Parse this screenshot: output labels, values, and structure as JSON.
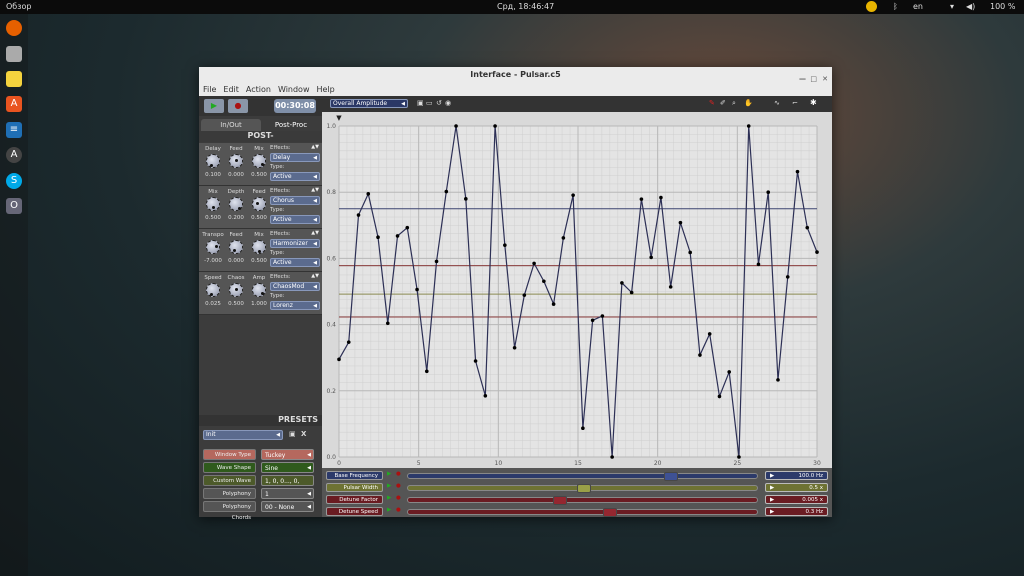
{
  "desktop": {
    "activities": "Обзор",
    "clock": "Срд, 18:46:47",
    "lang": "en",
    "battery": "100 %",
    "dock": [
      "firefox-icon",
      "files-icon",
      "notes-icon",
      "software-icon",
      "writer-icon",
      "updater-icon",
      "skype-icon",
      "app-icon"
    ]
  },
  "window": {
    "title": "Interface - Pulsar.c5",
    "menu": [
      "File",
      "Edit",
      "Action",
      "Window",
      "Help"
    ]
  },
  "transport": {
    "timer": "00:30:08"
  },
  "tabs": [
    "In/Out",
    "Post-Proc"
  ],
  "post_header": "POST-",
  "effects": [
    {
      "knobs": [
        {
          "label": "Delay",
          "value": "0.100"
        },
        {
          "label": "Feed",
          "value": "0.000"
        },
        {
          "label": "Mix",
          "value": "0.500"
        }
      ],
      "effect": "Delay",
      "type": "Active"
    },
    {
      "knobs": [
        {
          "label": "Mix",
          "value": "0.500"
        },
        {
          "label": "Depth",
          "value": "0.200"
        },
        {
          "label": "Feed",
          "value": "0.500"
        }
      ],
      "effect": "Chorus",
      "type": "Active"
    },
    {
      "knobs": [
        {
          "label": "Transpo",
          "value": "-7.000"
        },
        {
          "label": "Feed",
          "value": "0.000"
        },
        {
          "label": "Mix",
          "value": "0.500"
        }
      ],
      "effect": "Harmonizer",
      "type": "Active"
    },
    {
      "knobs": [
        {
          "label": "Speed",
          "value": "0.025"
        },
        {
          "label": "Chaos",
          "value": "0.500"
        },
        {
          "label": "Amp",
          "value": "1.000"
        }
      ],
      "effect": "ChaosMod",
      "type": "Lorenz"
    }
  ],
  "effects_label": "Effects:",
  "type_label": "Type:",
  "presets": {
    "header": "PRESETS",
    "current": "Init",
    "delete": "X",
    "rows": [
      {
        "label": "Window Type",
        "value": "Tuckey",
        "color": "#b5685e"
      },
      {
        "label": "Wave Shape",
        "value": "Sine",
        "color": "#2f5a1c"
      },
      {
        "label": "Custom Wave",
        "value": "1, 0, 0..., 0, 0.05",
        "color": "#4d5a2a"
      },
      {
        "label": "Polyphony Voices",
        "value": "1",
        "color": "#555555"
      },
      {
        "label": "Polyphony Chords",
        "value": "00 - None",
        "color": "#555555"
      }
    ]
  },
  "graph_select": "Overall Amplitude",
  "sliders": [
    {
      "label": "Base Frequency",
      "value": "100.0 Hz",
      "color": "#2c3a6a",
      "pos": 0.76
    },
    {
      "label": "Pulsar Width",
      "value": "0.5 x",
      "color": "#6e7233",
      "pos": 0.5
    },
    {
      "label": "Detune Factor",
      "value": "0.005 x",
      "color": "#6a1c22",
      "pos": 0.43
    },
    {
      "label": "Detune Speed",
      "value": "0.3 Hz",
      "color": "#6a1c22",
      "pos": 0.58
    }
  ],
  "chart_data": {
    "type": "line",
    "xlim": [
      0,
      30
    ],
    "ylim": [
      0,
      1
    ],
    "grid": true,
    "xticks": [
      "0",
      "5",
      "10",
      "15",
      "20",
      "25",
      "30"
    ],
    "yticks": [
      "0.0",
      "0.2",
      "0.4",
      "0.6",
      "0.8",
      "1.0"
    ],
    "y": [
      0.295,
      0.347,
      0.731,
      0.795,
      0.664,
      0.404,
      0.668,
      0.693,
      0.506,
      0.259,
      0.591,
      0.802,
      1.0,
      0.78,
      0.29,
      0.185,
      1.0,
      0.64,
      0.33,
      0.489,
      0.585,
      0.531,
      0.462,
      0.662,
      0.791,
      0.087,
      0.413,
      0.426,
      0.0,
      0.526,
      0.497,
      0.779,
      0.603,
      0.784,
      0.514,
      0.708,
      0.618,
      0.308,
      0.372,
      0.183,
      0.257,
      0.0,
      1.0,
      0.582,
      0.8,
      0.233,
      0.544,
      0.862,
      0.693,
      0.619
    ],
    "x_range_of_points": [
      0,
      30
    ],
    "reference_lines": [
      {
        "y": 0.75,
        "color": "#3d4470"
      },
      {
        "y": 0.578,
        "color": "#8a3c3c"
      },
      {
        "y": 0.492,
        "color": "#8a8a50"
      },
      {
        "y": 0.423,
        "color": "#8a3c3c"
      }
    ],
    "line_color": "#2c2f55"
  }
}
